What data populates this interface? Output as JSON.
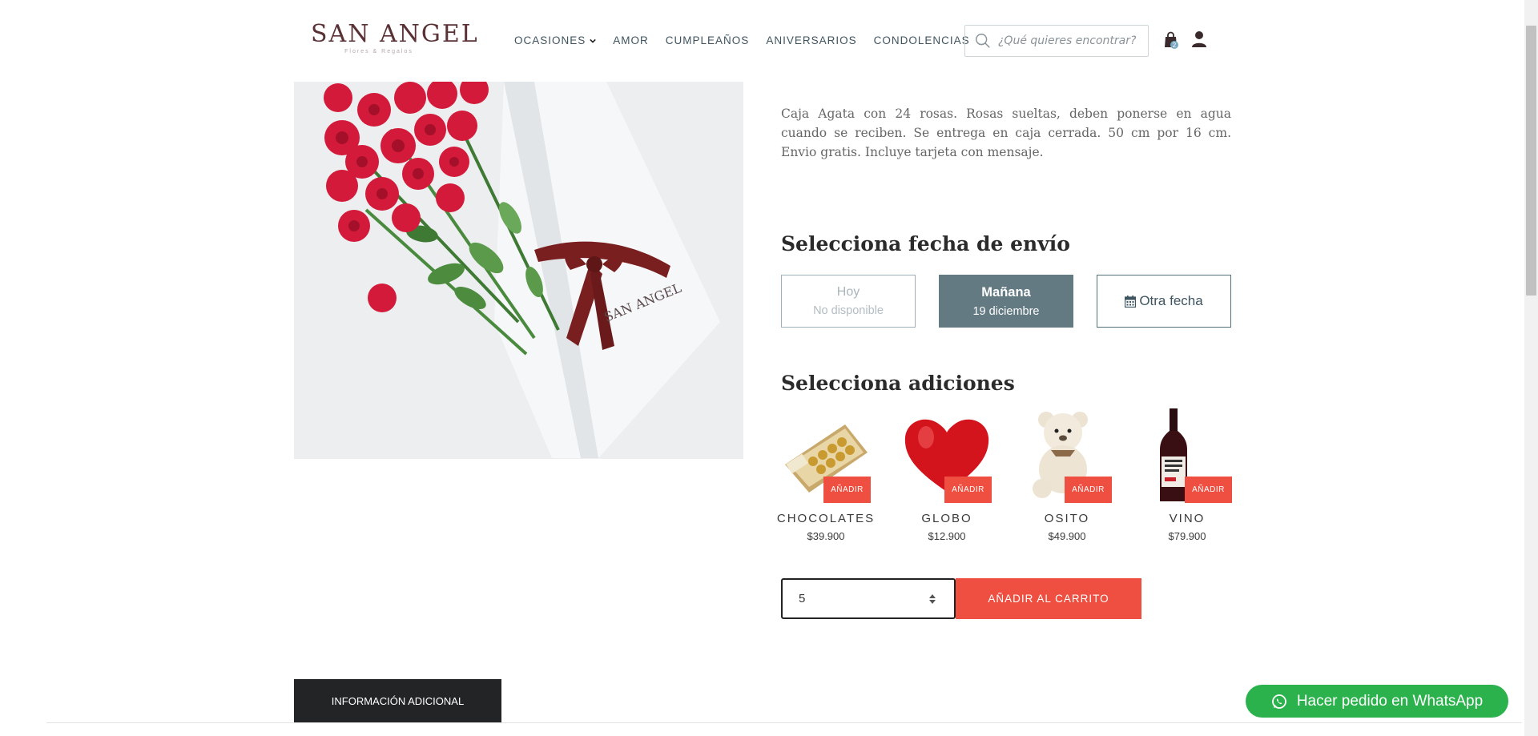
{
  "header": {
    "logo_text": "SAN ANGEL",
    "logo_sub": "Flores & Regalos",
    "nav": [
      "OCASIONES",
      "AMOR",
      "CUMPLEAÑOS",
      "ANIVERSARIOS",
      "CONDOLENCIAS"
    ],
    "search_placeholder": "¿Qué quieres encontrar?",
    "cart_count": "2"
  },
  "product": {
    "image_alt": "Caja Agata con 24 rosas rojas",
    "box_brand": "SAN ANGEL",
    "description": "Caja Agata con 24 rosas. Rosas sueltas, deben ponerse en agua cuando se reciben. Se entrega en caja cerrada. 50 cm por 16 cm. Envio gratis. Incluye tarjeta con mensaje."
  },
  "delivery": {
    "title": "Selecciona fecha de envío",
    "options": [
      {
        "label": "Hoy",
        "sub": "No disponible"
      },
      {
        "label": "Mañana",
        "sub": "19 diciembre"
      },
      {
        "label": "Otra fecha"
      }
    ]
  },
  "addons": {
    "title": "Selecciona adiciones",
    "button_label": "AÑADIR",
    "items": [
      {
        "name": "CHOCOLATES",
        "price": "$39.900"
      },
      {
        "name": "GLOBO",
        "price": "$12.900"
      },
      {
        "name": "OSITO",
        "price": "$49.900"
      },
      {
        "name": "VINO",
        "price": "$79.900"
      }
    ]
  },
  "cart": {
    "quantity": "5",
    "add_label": "AÑADIR AL CARRITO"
  },
  "tabs": {
    "info_label": "INFORMACIÓN ADICIONAL"
  },
  "whatsapp": {
    "label": "Hacer pedido en WhatsApp"
  },
  "colors": {
    "accent": "#ee4f40",
    "selected_date": "#637a83",
    "whatsapp": "#2bb24c",
    "nav_text": "#3e5460"
  }
}
